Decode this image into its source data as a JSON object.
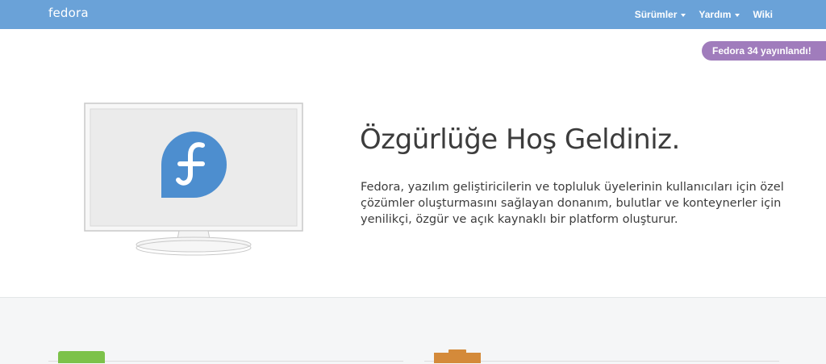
{
  "navbar": {
    "logo": "fedora",
    "items": [
      {
        "label": "Sürümler",
        "has_dropdown": true
      },
      {
        "label": "Yardım",
        "has_dropdown": true
      },
      {
        "label": "Wiki",
        "has_dropdown": false
      }
    ],
    "background_color": "#6aa2d8"
  },
  "badge": {
    "label": "Fedora 34 yayınlandı!",
    "color": "#a07cbc"
  },
  "hero": {
    "illustration_icon": "fedora-logo-icon",
    "title": "Özgürlüğe Hoş Geldiniz.",
    "description": "Fedora, yazılım geliştiricilerin ve topluluk üyelerinin kullanıcıları için özel çözümler oluşturmasını sağlayan donanım, bulutlar ve konteynerler için yenilikçi, özgür ve açık kaynaklı bir platform oluşturur."
  },
  "cards": [
    {
      "icon": "workstation-icon",
      "color": "#7cc24a"
    },
    {
      "icon": "server-icon",
      "color": "#d48a3a"
    }
  ]
}
